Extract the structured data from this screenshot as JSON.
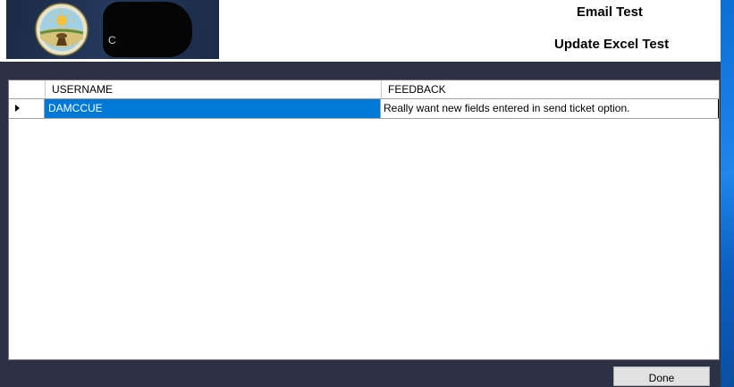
{
  "header": {
    "logo_letter": "C",
    "email_test_label": "Email Test",
    "update_excel_label": "Update Excel Test"
  },
  "grid": {
    "columns": [
      "USERNAME",
      "FEEDBACK"
    ],
    "rows": [
      {
        "username": "DAMCCUE",
        "feedback": "Really want new fields entered in send ticket option.",
        "selected": true
      }
    ]
  },
  "footer": {
    "done_label": "Done"
  },
  "colors": {
    "selection": "#0078d7",
    "window_background": "#2d3146",
    "desktop_accent": "#0a63c7"
  }
}
